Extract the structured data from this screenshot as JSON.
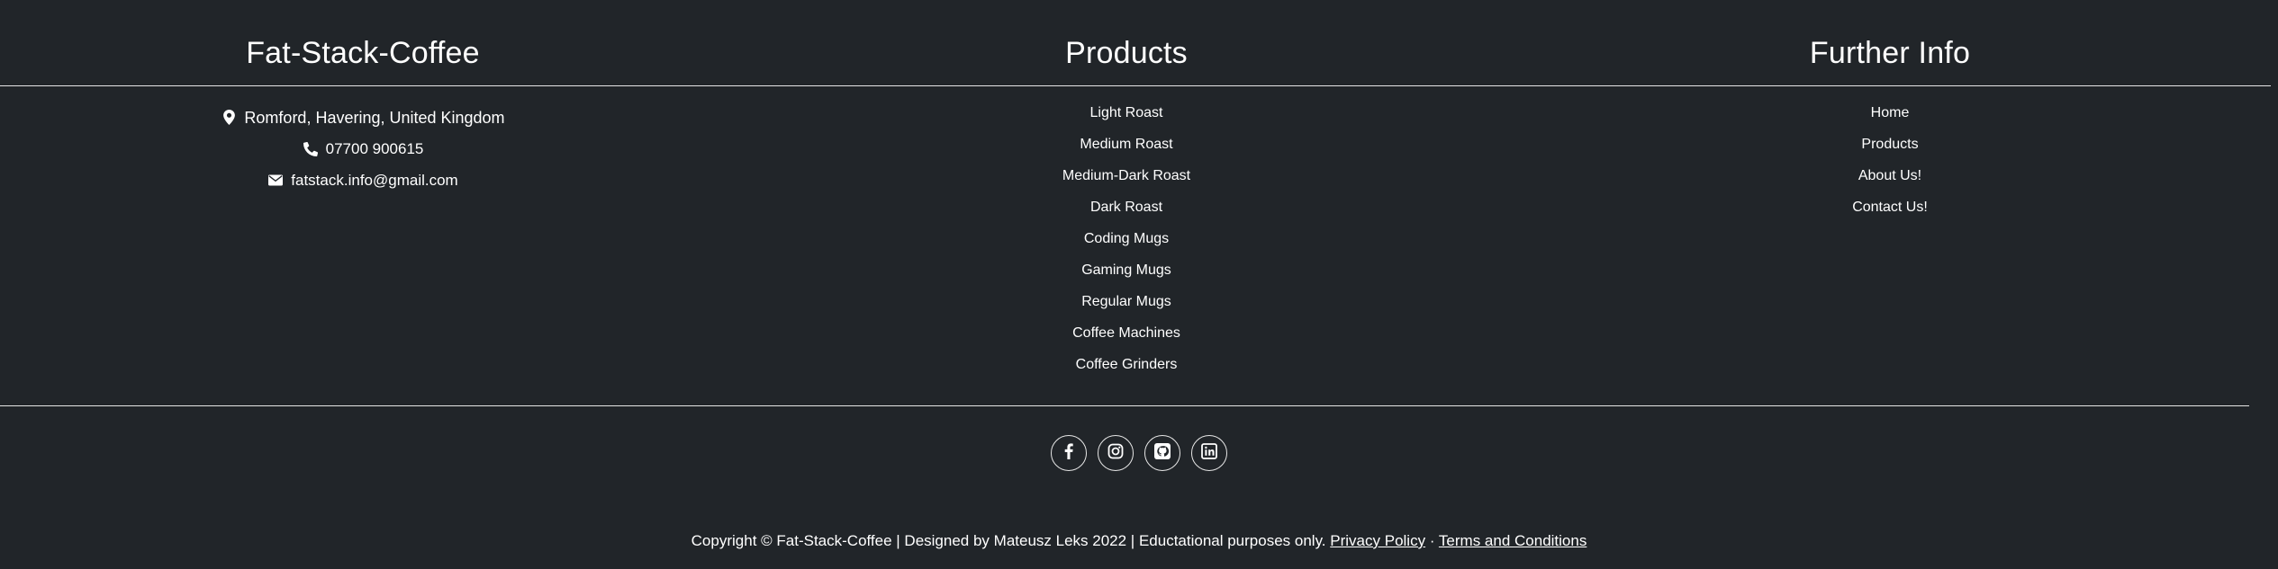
{
  "footer": {
    "brand": {
      "heading": "Fat-Stack-Coffee",
      "location": "Romford, Havering, United Kingdom",
      "phone": "07700 900615",
      "email": "fatstack.info@gmail.com",
      "icons": [
        "map-pin-icon",
        "phone-icon",
        "envelope-icon"
      ]
    },
    "products": {
      "heading": "Products",
      "items": [
        "Light Roast",
        "Medium Roast",
        "Medium-Dark Roast",
        "Dark Roast",
        "Coding Mugs",
        "Gaming Mugs",
        "Regular Mugs",
        "Coffee Machines",
        "Coffee Grinders"
      ]
    },
    "further_info": {
      "heading": "Further Info",
      "items": [
        "Home",
        "Products",
        "About Us!",
        "Contact Us!"
      ]
    },
    "social": {
      "icons": [
        "facebook-icon",
        "instagram-icon",
        "github-icon",
        "linkedin-icon"
      ]
    },
    "copyright": {
      "text": "Copyright © Fat-Stack-Coffee | Designed by Mateusz Leks 2022 | Eductational purposes only.",
      "privacy_label": "Privacy Policy",
      "separator": "·",
      "terms_label": "Terms and Conditions"
    },
    "colors": {
      "background": "#212529",
      "text": "#ffffff",
      "rule": "#e6e6e6"
    }
  }
}
